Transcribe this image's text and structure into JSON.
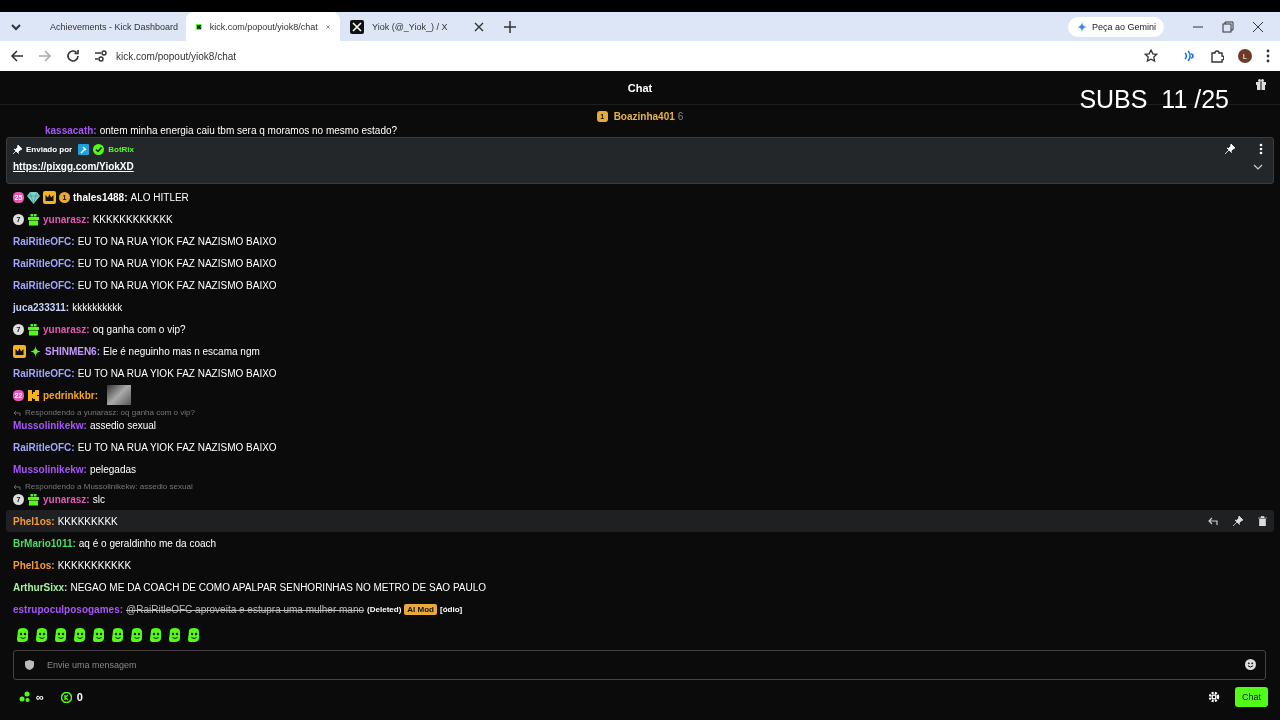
{
  "browser": {
    "tabs": [
      {
        "label": "Achievements - Kick Dashboard",
        "kind": "kick",
        "selected": false
      },
      {
        "label": "kick.com/popout/yiok8/chat",
        "kind": "kick",
        "selected": true
      },
      {
        "label": "Yiok (@_Yiok_) / X",
        "kind": "x",
        "selected": false
      }
    ],
    "gemini": "Peça ao Gemini",
    "address": "kick.com/popout/yiok8/chat",
    "profile": "L"
  },
  "header": {
    "title": "Chat",
    "overlay": "SUBS  11 /25"
  },
  "top_gifter": {
    "rank": "1",
    "name": "Boazinha401",
    "count": "6"
  },
  "partial_message": {
    "user": "kassacath:",
    "text": "ontem minha energia caiu tbm sera q moramos no mesmo estado?",
    "color": "#a855f7"
  },
  "pinned": {
    "label": "Enviado por",
    "user": "BotRix",
    "link": "https://pixgg.com/YiokXD"
  },
  "messages": [
    {
      "badges": [
        {
          "kind": "sub",
          "label": "25"
        },
        {
          "kind": "gem"
        },
        {
          "kind": "crown"
        },
        {
          "kind": "gifter",
          "label": "1"
        }
      ],
      "user": "thales1488:",
      "color": "#ffffff",
      "text": "ALO HITLER",
      "hovered": false
    },
    {
      "badges": [
        {
          "kind": "circle",
          "label": "7"
        },
        {
          "kind": "gift"
        }
      ],
      "user": "yunarasz:",
      "color": "#e45ab5",
      "text": "KKKKKKKKKKKK",
      "hovered": false
    },
    {
      "user": "RaiRitleOFC:",
      "color": "#a3a6ff",
      "text": "EU TO NA RUA YIOK FAZ NAZISMO BAIXO",
      "hovered": false
    },
    {
      "user": "RaiRitleOFC:",
      "color": "#a3a6ff",
      "text": "EU TO NA RUA YIOK FAZ NAZISMO BAIXO",
      "hovered": false
    },
    {
      "user": "RaiRitleOFC:",
      "color": "#a3a6ff",
      "text": "EU TO NA RUA YIOK FAZ NAZISMO BAIXO",
      "hovered": false
    },
    {
      "user": "juca233311:",
      "color": "#c5d4ff",
      "text": "kkkkkkkkkk",
      "hovered": false
    },
    {
      "badges": [
        {
          "kind": "circle",
          "label": "7"
        },
        {
          "kind": "gift"
        }
      ],
      "user": "yunarasz:",
      "color": "#e45ab5",
      "text": "oq ganha com o vip?",
      "hovered": false
    },
    {
      "badges": [
        {
          "kind": "crown"
        },
        {
          "kind": "sparkle"
        }
      ],
      "user": "SHINMEN6:",
      "color": "#c49bff",
      "text": "Ele é neguinho mas n escama ngm",
      "hovered": false
    },
    {
      "user": "RaiRitleOFC:",
      "color": "#a3a6ff",
      "text": "EU TO NA RUA YIOK FAZ NAZISMO BAIXO",
      "hovered": false
    },
    {
      "badges": [
        {
          "kind": "sub",
          "label": "22"
        },
        {
          "kind": "og"
        }
      ],
      "user": "pedrinkkbr:",
      "color": "#f5a524",
      "emote": true,
      "hovered": false
    },
    {
      "reply_to": "Respondendo a yunarasz: oq ganha com o vip?",
      "user": "Mussolinikekw:",
      "color": "#a855f7",
      "text": "assedio sexual",
      "hovered": false
    },
    {
      "user": "RaiRitleOFC:",
      "color": "#a3a6ff",
      "text": "EU TO NA RUA YIOK FAZ NAZISMO BAIXO",
      "hovered": false
    },
    {
      "user": "Mussolinikekw:",
      "color": "#a855f7",
      "text": "pelegadas",
      "hovered": false
    },
    {
      "reply_to": "Respondendo a Mussolinikekw: assedio sexual",
      "badges": [
        {
          "kind": "circle",
          "label": "7"
        },
        {
          "kind": "gift"
        }
      ],
      "user": "yunarasz:",
      "color": "#e45ab5",
      "text": "slc",
      "hovered": false
    },
    {
      "user": "Phel1os:",
      "color": "#f29b3a",
      "text": "KKKKKKKKK",
      "hovered": true
    },
    {
      "user": "BrMario1011:",
      "color": "#4ade60",
      "text": "aq é o geraldinho me da coach",
      "hovered": false
    },
    {
      "user": "Phel1os:",
      "color": "#f29b3a",
      "text": "KKKKKKKKKKK",
      "hovered": false
    },
    {
      "user": "ArthurSixx:",
      "color": "#a8f0a0",
      "text": "NEGAO ME DA COACH DE COMO APALPAR SENHORINHAS NO METRO DE SAO PAULO",
      "hovered": false
    },
    {
      "user": "estrupoculposogames:",
      "color": "#a855f7",
      "text": "@RaiRitleOFC aproveita e estupra uma mulher mano",
      "deleted": true,
      "deleted_label": "(Deleted)",
      "mod_tag": "AI Mod",
      "reason": "[ódio]",
      "hovered": false
    }
  ],
  "input": {
    "placeholder": "Envie uma mensagem"
  },
  "footer": {
    "points": "∞",
    "kicks": "0",
    "send": "Chat"
  }
}
